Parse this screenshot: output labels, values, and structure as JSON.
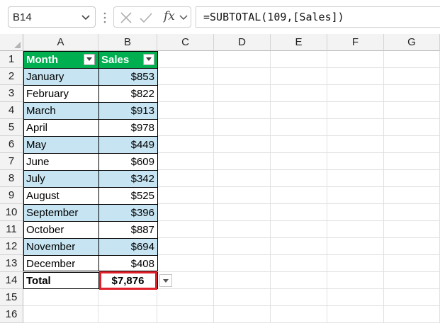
{
  "formula_bar": {
    "name_box": "B14",
    "fx_label": "fx",
    "formula": "=SUBTOTAL(109,[Sales])"
  },
  "columns": [
    "A",
    "B",
    "C",
    "D",
    "E",
    "F",
    "G"
  ],
  "rows": [
    "1",
    "2",
    "3",
    "4",
    "5",
    "6",
    "7",
    "8",
    "9",
    "10",
    "11",
    "12",
    "13",
    "14",
    "15",
    "16"
  ],
  "table": {
    "headers": [
      "Month",
      "Sales"
    ],
    "data": [
      {
        "month": "January",
        "sales": "$853"
      },
      {
        "month": "February",
        "sales": "$822"
      },
      {
        "month": "March",
        "sales": "$913"
      },
      {
        "month": "April",
        "sales": "$978"
      },
      {
        "month": "May",
        "sales": "$449"
      },
      {
        "month": "June",
        "sales": "$609"
      },
      {
        "month": "July",
        "sales": "$342"
      },
      {
        "month": "August",
        "sales": "$525"
      },
      {
        "month": "September",
        "sales": "$396"
      },
      {
        "month": "October",
        "sales": "$887"
      },
      {
        "month": "November",
        "sales": "$694"
      },
      {
        "month": "December",
        "sales": "$408"
      }
    ],
    "total_label": "Total",
    "total_value": "$7,876"
  },
  "colors": {
    "header_fill": "#00b050",
    "band_fill": "#c6e4f2",
    "selection_border": "#e0202a"
  },
  "icons": [
    "chevron-down-icon",
    "cancel-icon",
    "check-icon",
    "filter-dropdown-icon"
  ]
}
